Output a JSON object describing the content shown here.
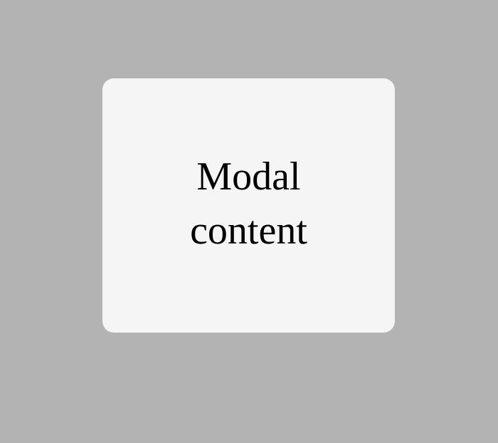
{
  "modal": {
    "content_text": "Modal content"
  },
  "colors": {
    "backdrop": "#b3b3b3",
    "modal_background": "#f5f5f5",
    "text": "#000000"
  }
}
